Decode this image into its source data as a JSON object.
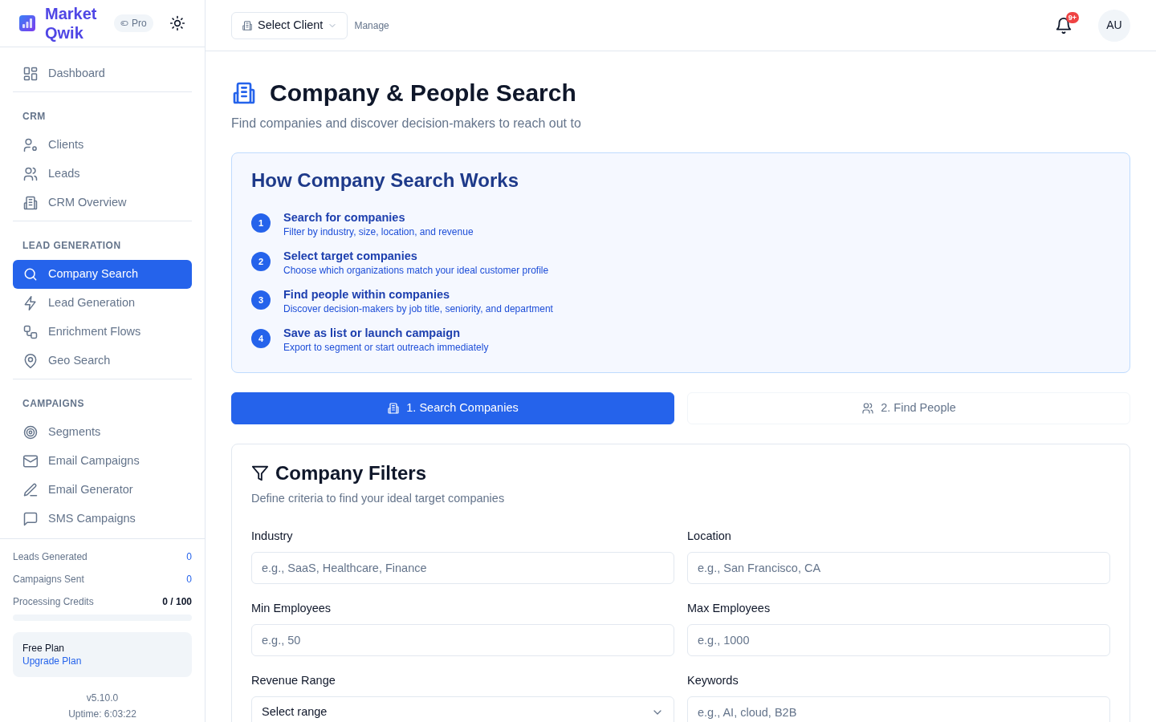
{
  "brand": {
    "name": "Market Qwik",
    "badge": "Pro"
  },
  "header": {
    "client_select": "Select Client",
    "manage": "Manage",
    "notifications": "9+",
    "avatar": "AU"
  },
  "sidebar": {
    "sections": [
      {
        "items": [
          {
            "label": "Dashboard",
            "selected": false
          }
        ]
      },
      {
        "title": "CRM",
        "items": [
          {
            "label": "Clients",
            "selected": false
          },
          {
            "label": "Leads",
            "selected": false
          },
          {
            "label": "CRM Overview",
            "selected": false
          }
        ]
      },
      {
        "title": "LEAD GENERATION",
        "items": [
          {
            "label": "Company Search",
            "selected": true
          },
          {
            "label": "Lead Generation",
            "selected": false
          },
          {
            "label": "Enrichment Flows",
            "selected": false
          },
          {
            "label": "Geo Search",
            "selected": false
          }
        ]
      },
      {
        "title": "CAMPAIGNS",
        "items": [
          {
            "label": "Segments",
            "selected": false
          },
          {
            "label": "Email Campaigns",
            "selected": false
          },
          {
            "label": "Email Generator",
            "selected": false
          },
          {
            "label": "SMS Campaigns",
            "selected": false
          }
        ]
      }
    ],
    "stats": [
      {
        "label": "Leads Generated",
        "value": "0",
        "kind": "count"
      },
      {
        "label": "Campaigns Sent",
        "value": "0",
        "kind": "count"
      },
      {
        "label": "Processing Credits",
        "value": "0 / 100",
        "kind": "ratio",
        "level": 0
      }
    ],
    "plan": {
      "title": "Free Plan",
      "link": "Upgrade Plan"
    },
    "version": "v5.10.0",
    "uptime": "Uptime: 6:03:22"
  },
  "page": {
    "title": "Company & People Search",
    "subtitle": "Find companies and discover decision-makers to reach out to"
  },
  "how_it_works": {
    "title": "How Company Search Works",
    "steps": [
      {
        "number": "1",
        "title": "Search for companies",
        "description": "Filter by industry, size, location, and revenue"
      },
      {
        "number": "2",
        "title": "Select target companies",
        "description": "Choose which organizations match your ideal customer profile"
      },
      {
        "number": "3",
        "title": "Find people within companies",
        "description": "Discover decision-makers by job title, seniority, and department"
      },
      {
        "number": "4",
        "title": "Save as list or launch campaign",
        "description": "Export to segment or start outreach immediately"
      }
    ]
  },
  "tabs": [
    {
      "label": "1. Search Companies",
      "selected": true
    },
    {
      "label": "2. Find People",
      "selected": false
    }
  ],
  "filters": {
    "title": "Company Filters",
    "subtitle": "Define criteria to find your ideal target companies",
    "fields": [
      {
        "label": "Industry",
        "kind": "input",
        "placeholder": "e.g., SaaS, Healthcare, Finance"
      },
      {
        "label": "Location",
        "kind": "input",
        "placeholder": "e.g., San Francisco, CA"
      },
      {
        "label": "Min Employees",
        "kind": "input",
        "placeholder": "e.g., 50"
      },
      {
        "label": "Max Employees",
        "kind": "input",
        "placeholder": "e.g., 1000"
      },
      {
        "label": "Revenue Range",
        "kind": "select",
        "value": "Select range"
      },
      {
        "label": "Keywords",
        "kind": "input",
        "placeholder": "e.g., AI, cloud, B2B"
      }
    ]
  }
}
